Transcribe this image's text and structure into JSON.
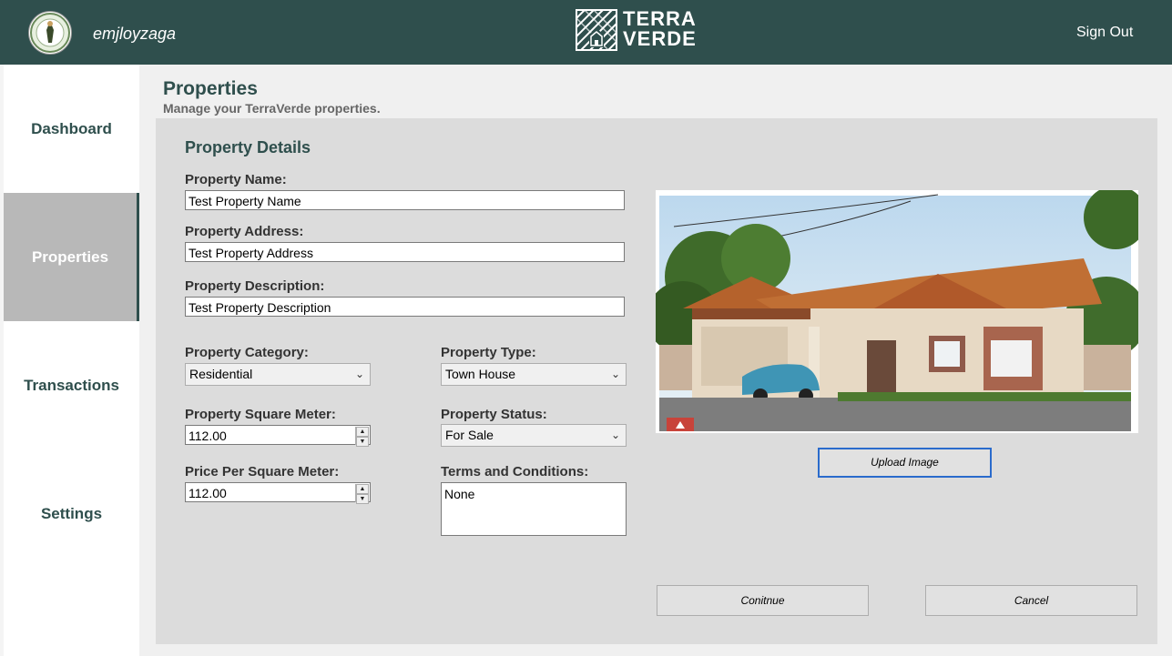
{
  "header": {
    "username": "emjloyzaga",
    "logo_line1": "TERRA",
    "logo_line2": "VERDE",
    "sign_out": "Sign Out"
  },
  "sidebar": {
    "items": [
      {
        "label": "Dashboard"
      },
      {
        "label": "Properties"
      },
      {
        "label": "Transactions"
      },
      {
        "label": "Settings"
      }
    ]
  },
  "page": {
    "title": "Properties",
    "subtitle": "Manage your TerraVerde properties."
  },
  "form": {
    "section_title": "Property Details",
    "name_label": "Property Name:",
    "name_value": "Test Property Name",
    "address_label": "Property Address:",
    "address_value": "Test Property Address",
    "description_label": "Property Description:",
    "description_value": "Test Property Description",
    "category_label": "Property Category:",
    "category_value": "Residential",
    "type_label": "Property Type:",
    "type_value": "Town House",
    "sqm_label": "Property Square Meter:",
    "sqm_value": "112.00",
    "status_label": "Property Status:",
    "status_value": "For Sale",
    "price_label": "Price Per Square Meter:",
    "price_value": "112.00",
    "terms_label": "Terms and Conditions:",
    "terms_value": "None"
  },
  "buttons": {
    "upload": "Upload Image",
    "continue": "Conitnue",
    "cancel": "Cancel"
  },
  "colors": {
    "header_bg": "#2f4f4d",
    "accent_text": "#2f4f4d",
    "active_nav_bg": "#b8b8b8",
    "panel_bg": "#dcdcdc"
  }
}
